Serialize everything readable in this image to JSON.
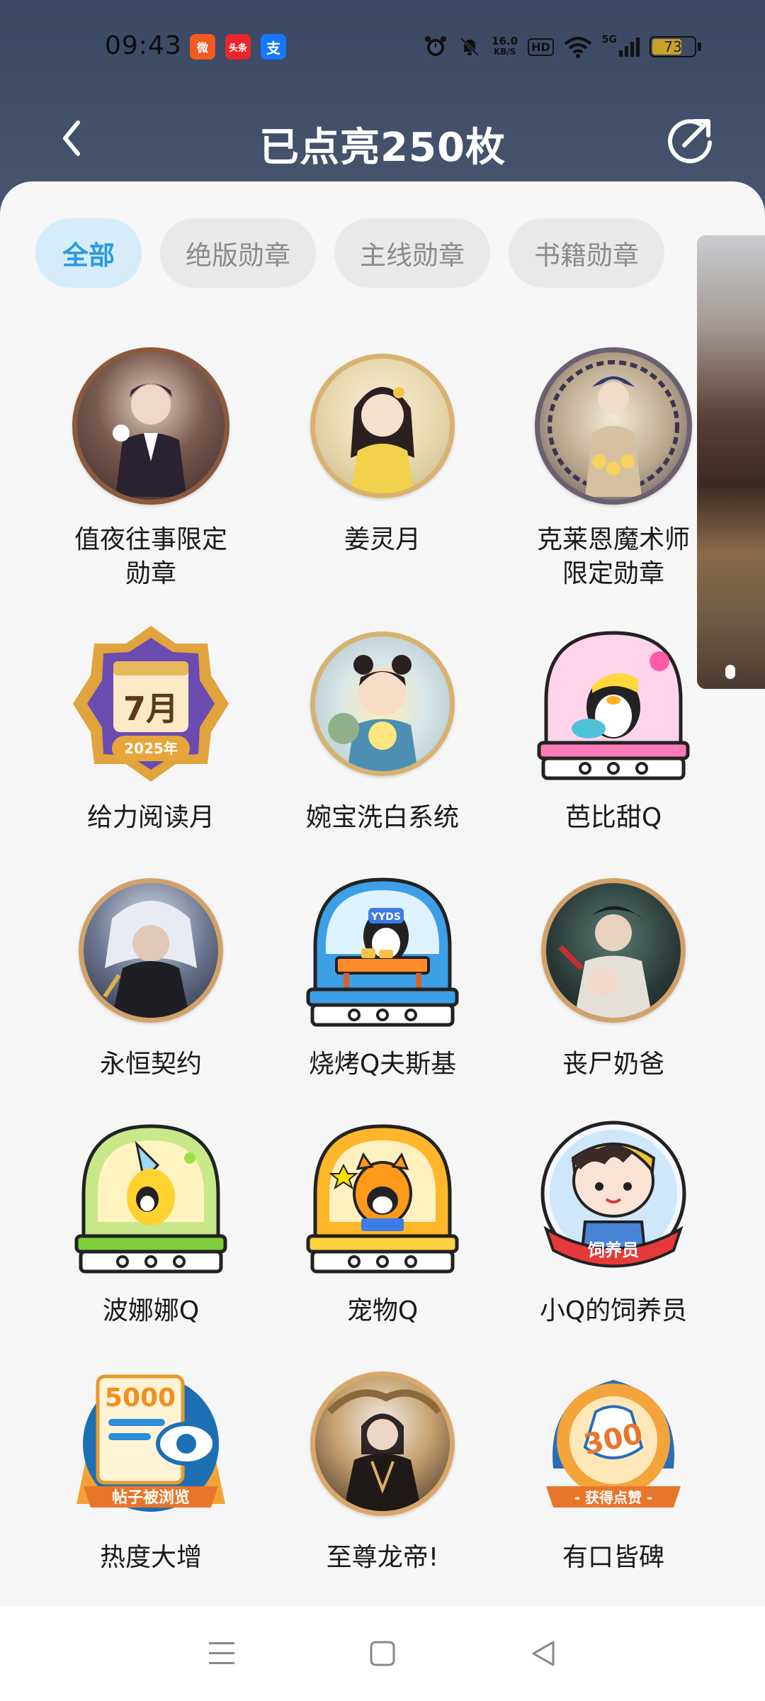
{
  "status_bar": {
    "time": "09:43",
    "apps": [
      {
        "name": "weibo-icon",
        "label": "微",
        "color": "#f25a1f"
      },
      {
        "name": "toutiao-icon",
        "label": "头条",
        "color": "#e8262b"
      },
      {
        "name": "alipay-icon",
        "label": "支",
        "color": "#1677ff"
      }
    ],
    "net_speed_value": "16.0",
    "net_speed_unit": "KB/S",
    "hd": "HD",
    "signal": "5G",
    "battery": "73",
    "battery_level": 0.73,
    "battery_color": "#c9a227"
  },
  "header": {
    "title": "已点亮250枚",
    "back_icon": "chevron-left-icon",
    "share_icon": "share-icon"
  },
  "tabs": [
    {
      "label": "全部",
      "active": true
    },
    {
      "label": "绝版勋章",
      "active": false
    },
    {
      "label": "主线勋章",
      "active": false
    },
    {
      "label": "书籍勋章",
      "active": false
    }
  ],
  "badges": [
    {
      "name": "值夜往事限定\n勋章",
      "line1": "值夜往事限定",
      "line2": "勋章",
      "icon": "portrait-badge-icon"
    },
    {
      "name": "姜灵月",
      "line1": "姜灵月",
      "line2": "",
      "icon": "portrait-badge-icon"
    },
    {
      "name": "克莱恩魔术师\n限定勋章",
      "line1": "克莱恩魔术师",
      "line2": "限定勋章",
      "icon": "portrait-badge-icon"
    },
    {
      "name": "给力阅读月",
      "line1": "给力阅读月",
      "line2": "",
      "icon": "calendar-badge-icon",
      "text_month": "7月",
      "text_year": "2025年"
    },
    {
      "name": "婉宝洗白系统",
      "line1": "婉宝洗白系统",
      "line2": "",
      "icon": "portrait-badge-icon"
    },
    {
      "name": "芭比甜Q",
      "line1": "芭比甜Q",
      "line2": "",
      "icon": "penguin-globe-icon"
    },
    {
      "name": "永恒契约",
      "line1": "永恒契约",
      "line2": "",
      "icon": "portrait-badge-icon"
    },
    {
      "name": "烧烤Q夫斯基",
      "line1": "烧烤Q夫斯基",
      "line2": "",
      "icon": "penguin-globe-icon",
      "text_tag": "YYDS"
    },
    {
      "name": "丧尸奶爸",
      "line1": "丧尸奶爸",
      "line2": "",
      "icon": "portrait-badge-icon"
    },
    {
      "name": "波娜娜Q",
      "line1": "波娜娜Q",
      "line2": "",
      "icon": "penguin-globe-icon"
    },
    {
      "name": "宠物Q",
      "line1": "宠物Q",
      "line2": "",
      "icon": "penguin-globe-icon"
    },
    {
      "name": "小Q的饲养员",
      "line1": "小Q的饲养员",
      "line2": "",
      "icon": "keeper-badge-icon",
      "text_ribbon": "饲养员"
    },
    {
      "name": "热度大增",
      "line1": "热度大增",
      "line2": "",
      "icon": "views-badge-icon",
      "text_number": "5000",
      "text_ribbon": "帖子被浏览"
    },
    {
      "name": "至尊龙帝!",
      "line1": "至尊龙帝!",
      "line2": "",
      "icon": "portrait-badge-icon"
    },
    {
      "name": "有口皆碑",
      "line1": "有口皆碑",
      "line2": "",
      "icon": "likes-badge-icon",
      "text_number": "300",
      "text_ribbon": "- 获得点赞 -"
    }
  ],
  "nav": {
    "menu_icon": "menu-icon",
    "home_icon": "home-square-icon",
    "back_icon": "back-triangle-icon"
  }
}
